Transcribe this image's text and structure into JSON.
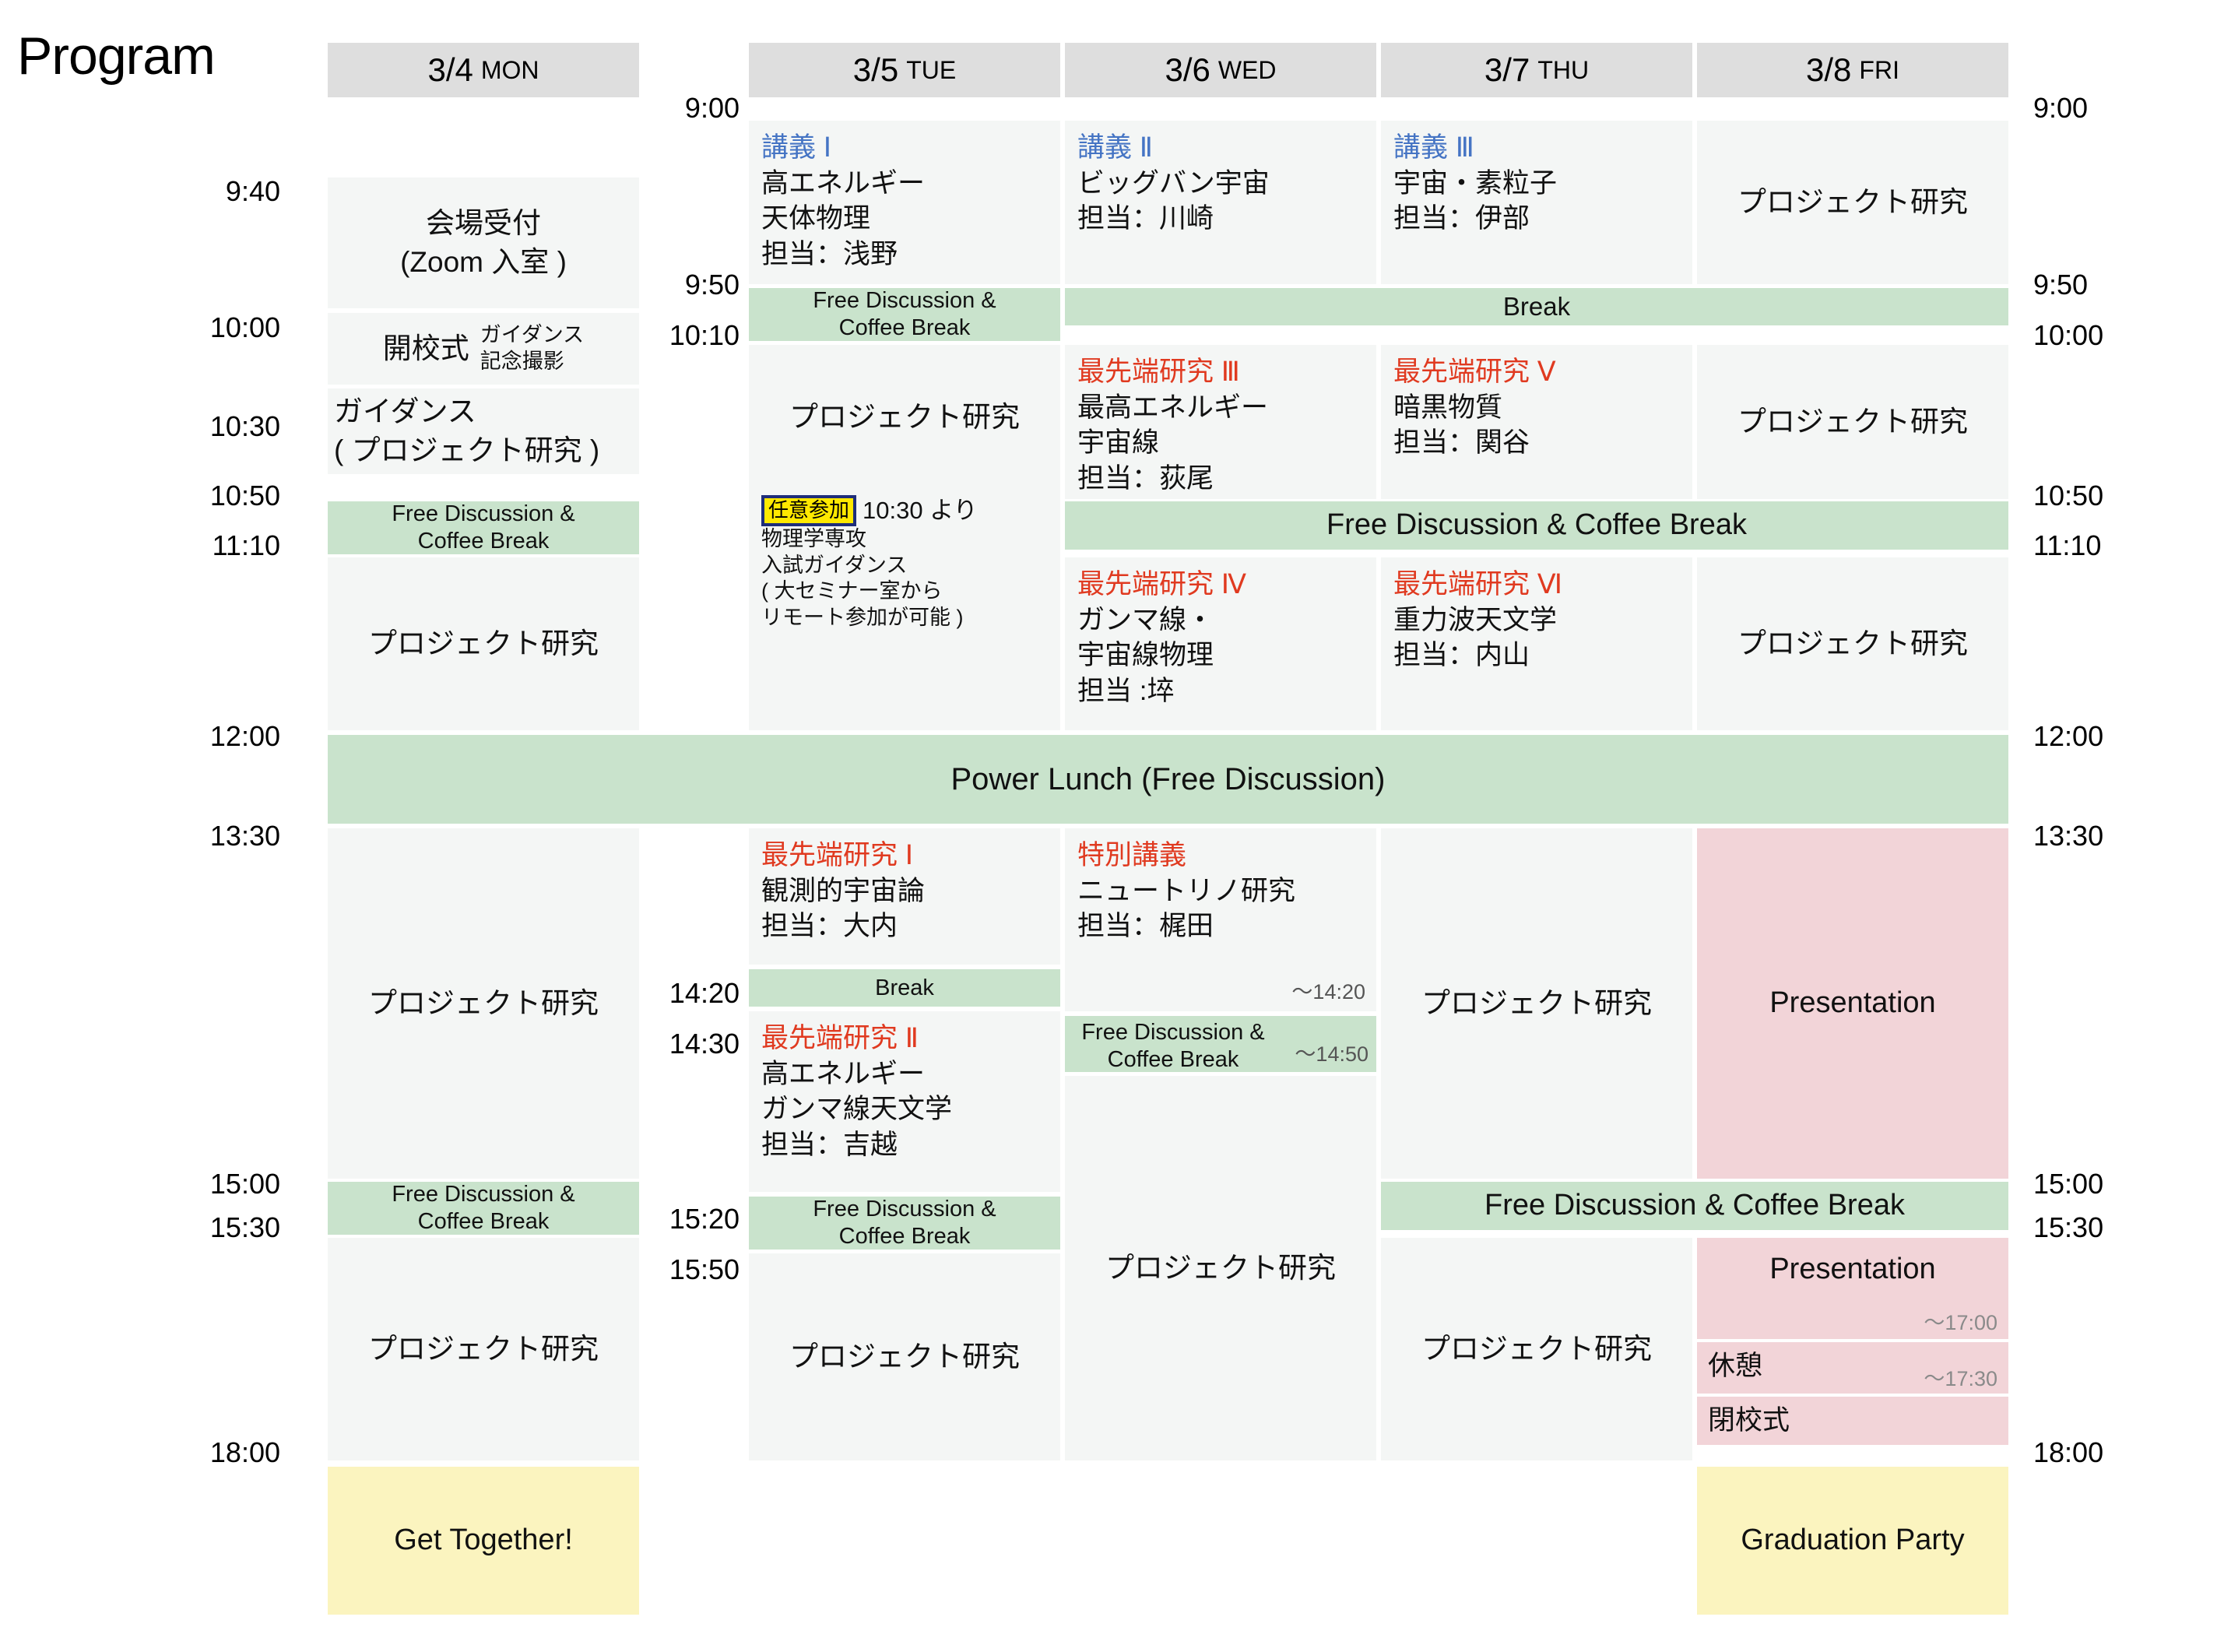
{
  "page_title": "Program",
  "days": [
    {
      "date": "3/4",
      "weekday": "MON"
    },
    {
      "date": "3/5",
      "weekday": "TUE"
    },
    {
      "date": "3/6",
      "weekday": "WED"
    },
    {
      "date": "3/7",
      "weekday": "THU"
    },
    {
      "date": "3/8",
      "weekday": "FRI"
    }
  ],
  "times_left": [
    "9:40",
    "10:00",
    "10:30",
    "10:50",
    "11:10",
    "12:00",
    "13:30",
    "15:00",
    "15:30",
    "18:00"
  ],
  "times_mid_top": [
    "9:00",
    "9:50",
    "10:10"
  ],
  "times_mid_bottom": [
    "14:20",
    "14:30",
    "15:20",
    "15:50"
  ],
  "times_right": [
    "9:00",
    "9:50",
    "10:00",
    "10:50",
    "11:10",
    "12:00",
    "13:30",
    "15:00",
    "15:30",
    "18:00"
  ],
  "colors": {
    "header_gray": "#dedede",
    "cell_gray": "#f4f6f5",
    "break_green": "#c9e3cc",
    "presentation_pink": "#f2d4d8",
    "party_yellow": "#fbf4bf",
    "lecture_blue": "#4574c4",
    "advanced_red": "#e03a20",
    "badge_yellow": "#ffe900",
    "badge_border": "#1f2e7a"
  },
  "mon": {
    "reception_l1": "会場受付",
    "reception_l2": "(Zoom 入室 )",
    "opening": "開校式",
    "opening_sub_l1": "ガイダンス",
    "opening_sub_l2": "記念撮影",
    "guidance_l1": "ガイダンス",
    "guidance_l2": "( プロジェクト研究 )",
    "break1_l1": "Free Discussion &",
    "break1_l2": "Coffee Break",
    "project1": "プロジェクト研究",
    "project2": "プロジェクト研究",
    "break2_l1": "Free Discussion &",
    "break2_l2": "Coffee Break",
    "project3": "プロジェクト研究",
    "get_together": "Get Together!"
  },
  "tue": {
    "lecture_tag": "講義 Ⅰ",
    "lecture_l1": "高エネルギー",
    "lecture_l2": "天体物理",
    "lecture_l3": "担当：浅野",
    "break1_l1": "Free Discussion &",
    "break1_l2": "Coffee Break",
    "project1": "プロジェクト研究",
    "optional_badge": "任意参加",
    "optional_time": "10:30 より",
    "optional_l1": "物理学専攻",
    "optional_l2": "入試ガイダンス",
    "optional_l3": "( 大セミナー室から",
    "optional_l4": "リモート参加が可能 )",
    "adv1_tag": "最先端研究 Ⅰ",
    "adv1_l1": "観測的宇宙論",
    "adv1_l2": "担当：大内",
    "break2": "Break",
    "adv2_tag": "最先端研究 Ⅱ",
    "adv2_l1": "高エネルギー",
    "adv2_l2": "ガンマ線天文学",
    "adv2_l3": "担当：吉越",
    "break3_l1": "Free Discussion &",
    "break3_l2": "Coffee Break",
    "project2": "プロジェクト研究"
  },
  "wed": {
    "lecture_tag": "講義 Ⅱ",
    "lecture_l1": "ビッグバン宇宙",
    "lecture_l2": "担当：川崎",
    "adv3_tag": "最先端研究 Ⅲ",
    "adv3_l1": "最高エネルギー",
    "adv3_l2": "宇宙線",
    "adv3_l3": "担当：荻尾",
    "adv4_tag": "最先端研究 Ⅳ",
    "adv4_l1": "ガンマ線・",
    "adv4_l2": "宇宙線物理",
    "adv4_l3": "担当 :埣",
    "special_tag": "特別講義",
    "special_l1": "ニュートリノ研究",
    "special_l2": "担当：梶田",
    "special_end": "〜14:20",
    "break_l1": "Free Discussion &",
    "break_l2": "Coffee Break",
    "break_end": "〜14:50",
    "project": "プロジェクト研究"
  },
  "thu": {
    "lecture_tag": "講義 Ⅲ",
    "lecture_l1": "宇宙・素粒子",
    "lecture_l2": "担当：伊部",
    "adv5_tag": "最先端研究 Ⅴ",
    "adv5_l1": "暗黒物質",
    "adv5_l2": "担当：関谷",
    "adv6_tag": "最先端研究 Ⅵ",
    "adv6_l1": "重力波天文学",
    "adv6_l2": "担当：内山",
    "project1": "プロジェクト研究",
    "project2": "プロジェクト研究"
  },
  "fri": {
    "project1": "プロジェクト研究",
    "project2": "プロジェクト研究",
    "project3": "プロジェクト研究",
    "presentation1": "Presentation",
    "presentation2": "Presentation",
    "presentation2_end": "〜17:00",
    "rest": "休憩",
    "rest_end": "〜17:30",
    "closing": "閉校式",
    "graduation_party": "Graduation Party"
  },
  "shared": {
    "break_morning_tue": "Break",
    "break_morning_label": "Break",
    "free_discussion_coffee": "Free Discussion  &  Coffee Break",
    "power_lunch": "Power Lunch (Free Discussion)",
    "free_discussion_coffee_pm": "Free Discussion  &  Coffee Break"
  }
}
